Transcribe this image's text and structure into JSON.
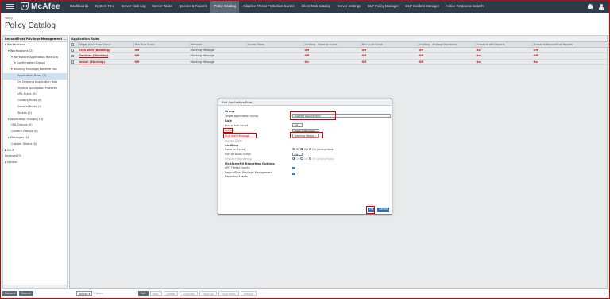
{
  "nav": {
    "logo": "McAfee",
    "items": [
      "Dashboards",
      "System Tree",
      "Server Task Log",
      "Server Tasks",
      "Queries & Reports",
      "Policy Catalog",
      "Adaptive Threat Protection Events",
      "Client Task Catalog",
      "Server Settings",
      "DLP Policy Manager",
      "DLP Incident Manager",
      "Active Response Search"
    ],
    "active_index": 5
  },
  "breadcrumb": "Policy",
  "page_title": "Policy Catalog",
  "page_counter": "Policy Mark",
  "tree": {
    "header": "BeyondTrust Privilege Management ...",
    "items": [
      {
        "label": "▾ Workstations",
        "indent": 0
      },
      {
        "label": "▾ Workstations (2)",
        "indent": 1
      },
      {
        "label": "▾ Workspace Application Rule(Gro",
        "indent": 2
      },
      {
        "label": "▾ Confirmation(Group)",
        "indent": 3
      },
      {
        "label": "▾ Blocking Message(Beflame Has",
        "indent": 2,
        "selected": true
      },
      {
        "label": "Application Rules (3)",
        "indent": 4,
        "selected": true
      },
      {
        "label": "On Demand Application Rule",
        "indent": 4
      },
      {
        "label": "Trusted Application Protectio",
        "indent": 4
      },
      {
        "label": "URL Rules (0)",
        "indent": 4
      },
      {
        "label": "Content Rules (0)",
        "indent": 4
      },
      {
        "label": "General Rules (1)",
        "indent": 4
      },
      {
        "label": "Tokens (0)",
        "indent": 4
      },
      {
        "label": "▾ Application Groups (16)",
        "indent": 1
      },
      {
        "label": "URL Groups (0)",
        "indent": 2
      },
      {
        "label": "Content Groups (0)",
        "indent": 2
      },
      {
        "label": "▸ Messages (4)",
        "indent": 1
      },
      {
        "label": "Custom Tokens (0)",
        "indent": 2
      },
      {
        "label": "▸ OS X",
        "indent": 0
      },
      {
        "label": "Licenses (0)",
        "indent": 0
      },
      {
        "label": "▸ Utilities",
        "indent": 0
      }
    ]
  },
  "main": {
    "header": "Application Rules",
    "columns": [
      "",
      "Target Application Group",
      "Run Rule Script",
      "Message",
      "Access Token",
      "Auditing - Raise an Event",
      "Run Audit Script",
      "Auditing - Privilege Monitoring",
      "Events to ePO Reports",
      "Events to BeyondTrust Reports"
    ],
    "rows": [
      [
        "",
        "CMD Wait (Blocking)",
        "Off",
        "Blocking Message",
        "",
        "Off",
        "Off",
        "Off",
        "No",
        "Off"
      ],
      [
        "",
        "Services (Blocking)",
        "Off",
        "Blocking Message",
        "",
        "Off",
        "Off",
        "Off",
        "No",
        "Off"
      ],
      [
        "",
        "Install (Blocking)",
        "Off",
        "Blocking Message",
        "",
        "On",
        "Off",
        "Off",
        "No",
        "No"
      ]
    ]
  },
  "bottom": {
    "left_buttons": [
      "Discard",
      "Submit"
    ],
    "select": "Actions",
    "select_suffix": "0 items",
    "edit": "Edit",
    "ghost_buttons": [
      "New",
      "Delete",
      "Duplicate",
      "Move up",
      "Move down",
      "Refresh"
    ]
  },
  "modal": {
    "title": "Add Application Rule",
    "group_heading": "Group",
    "target_label": "Target Application Group",
    "target_value": "Blocked Applications",
    "rule_heading": "Rule",
    "run_rule_script_label": "Run a Rule Script",
    "run_rule_script_value": "Off",
    "action_label": "Action",
    "action_value": "Block Execution",
    "end_user_msg_label": "End User Message",
    "end_user_msg_value": "Blocking Messa",
    "access_token_label": "Access Token",
    "auditing_heading": "Auditing",
    "raise_event_label": "Raise an Event",
    "raise_event_options": [
      "Off",
      "On",
      "On (Anonymous)"
    ],
    "run_audit_label": "Run an Audit Script",
    "run_audit_value": "Off",
    "priv_mon_label": "Privilege Monitoring",
    "priv_mon_options": [
      "Off",
      "On",
      "On (Anonymous)"
    ],
    "epo_heading": "McAfee ePO Reporting Options",
    "epo_threat_label": "ePO Threat Events",
    "bt_reporting_label_1": "BeyondTrust Privilege Management",
    "bt_reporting_label_2": "Reporting Events",
    "ok": "OK",
    "cancel": "Cancel"
  },
  "colors": {
    "nav_bg": "#2f3b48",
    "highlight": "#d40000",
    "primary": "#2b6fb6",
    "rule_text": "#c40000"
  }
}
